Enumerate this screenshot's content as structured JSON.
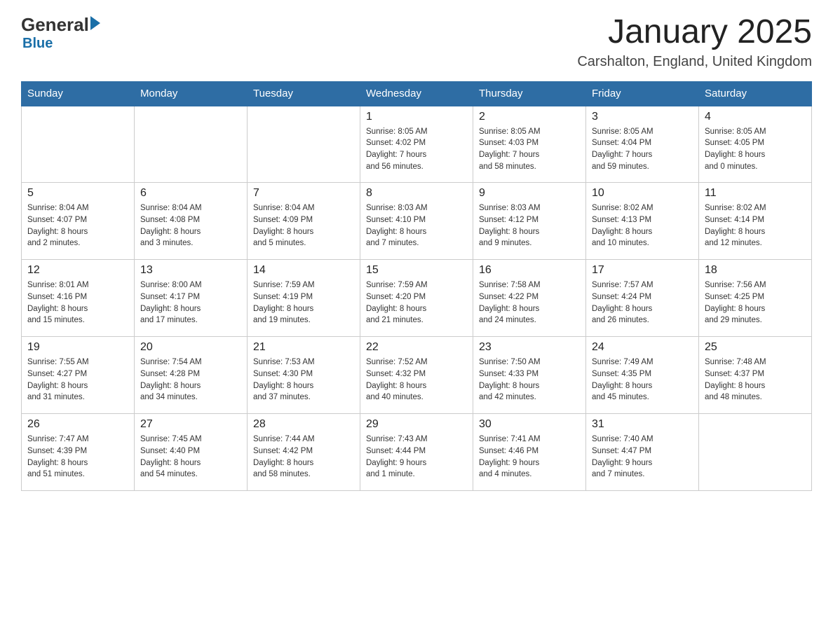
{
  "header": {
    "logo_general": "General",
    "logo_blue": "Blue",
    "title": "January 2025",
    "subtitle": "Carshalton, England, United Kingdom"
  },
  "weekdays": [
    "Sunday",
    "Monday",
    "Tuesday",
    "Wednesday",
    "Thursday",
    "Friday",
    "Saturday"
  ],
  "weeks": [
    [
      {
        "day": "",
        "info": ""
      },
      {
        "day": "",
        "info": ""
      },
      {
        "day": "",
        "info": ""
      },
      {
        "day": "1",
        "info": "Sunrise: 8:05 AM\nSunset: 4:02 PM\nDaylight: 7 hours\nand 56 minutes."
      },
      {
        "day": "2",
        "info": "Sunrise: 8:05 AM\nSunset: 4:03 PM\nDaylight: 7 hours\nand 58 minutes."
      },
      {
        "day": "3",
        "info": "Sunrise: 8:05 AM\nSunset: 4:04 PM\nDaylight: 7 hours\nand 59 minutes."
      },
      {
        "day": "4",
        "info": "Sunrise: 8:05 AM\nSunset: 4:05 PM\nDaylight: 8 hours\nand 0 minutes."
      }
    ],
    [
      {
        "day": "5",
        "info": "Sunrise: 8:04 AM\nSunset: 4:07 PM\nDaylight: 8 hours\nand 2 minutes."
      },
      {
        "day": "6",
        "info": "Sunrise: 8:04 AM\nSunset: 4:08 PM\nDaylight: 8 hours\nand 3 minutes."
      },
      {
        "day": "7",
        "info": "Sunrise: 8:04 AM\nSunset: 4:09 PM\nDaylight: 8 hours\nand 5 minutes."
      },
      {
        "day": "8",
        "info": "Sunrise: 8:03 AM\nSunset: 4:10 PM\nDaylight: 8 hours\nand 7 minutes."
      },
      {
        "day": "9",
        "info": "Sunrise: 8:03 AM\nSunset: 4:12 PM\nDaylight: 8 hours\nand 9 minutes."
      },
      {
        "day": "10",
        "info": "Sunrise: 8:02 AM\nSunset: 4:13 PM\nDaylight: 8 hours\nand 10 minutes."
      },
      {
        "day": "11",
        "info": "Sunrise: 8:02 AM\nSunset: 4:14 PM\nDaylight: 8 hours\nand 12 minutes."
      }
    ],
    [
      {
        "day": "12",
        "info": "Sunrise: 8:01 AM\nSunset: 4:16 PM\nDaylight: 8 hours\nand 15 minutes."
      },
      {
        "day": "13",
        "info": "Sunrise: 8:00 AM\nSunset: 4:17 PM\nDaylight: 8 hours\nand 17 minutes."
      },
      {
        "day": "14",
        "info": "Sunrise: 7:59 AM\nSunset: 4:19 PM\nDaylight: 8 hours\nand 19 minutes."
      },
      {
        "day": "15",
        "info": "Sunrise: 7:59 AM\nSunset: 4:20 PM\nDaylight: 8 hours\nand 21 minutes."
      },
      {
        "day": "16",
        "info": "Sunrise: 7:58 AM\nSunset: 4:22 PM\nDaylight: 8 hours\nand 24 minutes."
      },
      {
        "day": "17",
        "info": "Sunrise: 7:57 AM\nSunset: 4:24 PM\nDaylight: 8 hours\nand 26 minutes."
      },
      {
        "day": "18",
        "info": "Sunrise: 7:56 AM\nSunset: 4:25 PM\nDaylight: 8 hours\nand 29 minutes."
      }
    ],
    [
      {
        "day": "19",
        "info": "Sunrise: 7:55 AM\nSunset: 4:27 PM\nDaylight: 8 hours\nand 31 minutes."
      },
      {
        "day": "20",
        "info": "Sunrise: 7:54 AM\nSunset: 4:28 PM\nDaylight: 8 hours\nand 34 minutes."
      },
      {
        "day": "21",
        "info": "Sunrise: 7:53 AM\nSunset: 4:30 PM\nDaylight: 8 hours\nand 37 minutes."
      },
      {
        "day": "22",
        "info": "Sunrise: 7:52 AM\nSunset: 4:32 PM\nDaylight: 8 hours\nand 40 minutes."
      },
      {
        "day": "23",
        "info": "Sunrise: 7:50 AM\nSunset: 4:33 PM\nDaylight: 8 hours\nand 42 minutes."
      },
      {
        "day": "24",
        "info": "Sunrise: 7:49 AM\nSunset: 4:35 PM\nDaylight: 8 hours\nand 45 minutes."
      },
      {
        "day": "25",
        "info": "Sunrise: 7:48 AM\nSunset: 4:37 PM\nDaylight: 8 hours\nand 48 minutes."
      }
    ],
    [
      {
        "day": "26",
        "info": "Sunrise: 7:47 AM\nSunset: 4:39 PM\nDaylight: 8 hours\nand 51 minutes."
      },
      {
        "day": "27",
        "info": "Sunrise: 7:45 AM\nSunset: 4:40 PM\nDaylight: 8 hours\nand 54 minutes."
      },
      {
        "day": "28",
        "info": "Sunrise: 7:44 AM\nSunset: 4:42 PM\nDaylight: 8 hours\nand 58 minutes."
      },
      {
        "day": "29",
        "info": "Sunrise: 7:43 AM\nSunset: 4:44 PM\nDaylight: 9 hours\nand 1 minute."
      },
      {
        "day": "30",
        "info": "Sunrise: 7:41 AM\nSunset: 4:46 PM\nDaylight: 9 hours\nand 4 minutes."
      },
      {
        "day": "31",
        "info": "Sunrise: 7:40 AM\nSunset: 4:47 PM\nDaylight: 9 hours\nand 7 minutes."
      },
      {
        "day": "",
        "info": ""
      }
    ]
  ]
}
